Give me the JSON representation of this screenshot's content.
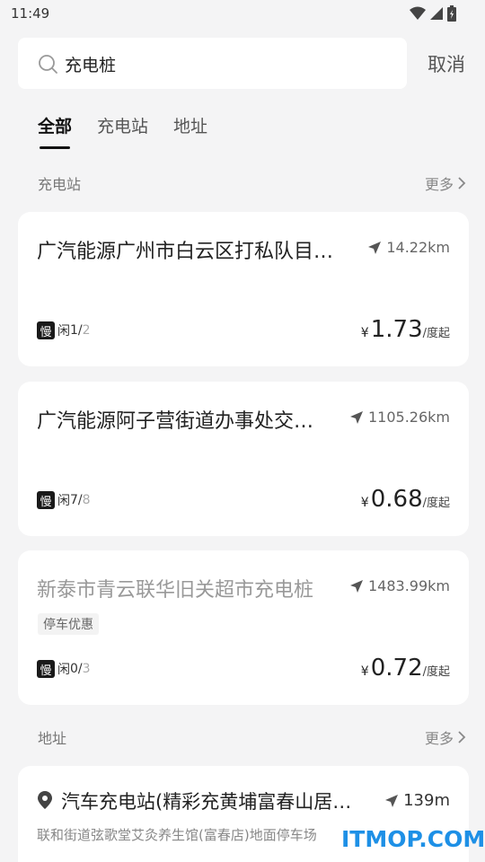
{
  "status": {
    "time": "11:49"
  },
  "search": {
    "query": "充电桩",
    "cancel_label": "取消"
  },
  "tabs": [
    {
      "label": "全部",
      "active": true
    },
    {
      "label": "充电站",
      "active": false
    },
    {
      "label": "地址",
      "active": false
    }
  ],
  "stations_section": {
    "title": "充电站",
    "more_label": "更多"
  },
  "stations": [
    {
      "name": "广汽能源广州市白云区打私队目…",
      "distance": "14.22km",
      "tag": "",
      "slow_label": "慢",
      "idle_label": "闲",
      "idle": "1",
      "sep": "/",
      "total": "2",
      "currency": "¥",
      "price": "1.73",
      "price_unit": "/度起",
      "dim": false
    },
    {
      "name": "广汽能源阿子营街道办事处交…",
      "distance": "1105.26km",
      "tag": "",
      "slow_label": "慢",
      "idle_label": "闲",
      "idle": "7",
      "sep": "/",
      "total": "8",
      "currency": "¥",
      "price": "0.68",
      "price_unit": "/度起",
      "dim": false
    },
    {
      "name": "新泰市青云联华旧关超市充电桩",
      "distance": "1483.99km",
      "tag": "停车优惠",
      "slow_label": "慢",
      "idle_label": "闲",
      "idle": "0",
      "sep": "/",
      "total": "3",
      "currency": "¥",
      "price": "0.72",
      "price_unit": "/度起",
      "dim": true
    }
  ],
  "address_section": {
    "title": "地址",
    "more_label": "更多"
  },
  "addresses": [
    {
      "name": "汽车充电站(精彩充黄埔富春山居…",
      "distance": "139m",
      "sub": "联和街道弦歌堂艾灸养生馆(富春店)地面停车场"
    }
  ],
  "watermark": "ITMOP.COM",
  "colors": {
    "background": "#f4f4f5",
    "card": "#ffffff",
    "watermark": "#1e90e6"
  },
  "icons": [
    "wifi-icon",
    "signal-icon",
    "battery-icon",
    "search-icon",
    "chevron-right-icon",
    "navigation-arrow-icon",
    "location-pin-icon"
  ]
}
